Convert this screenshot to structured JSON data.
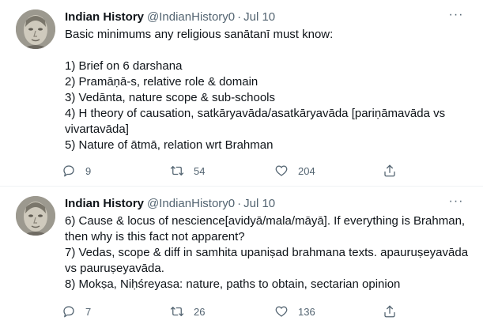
{
  "author": {
    "name": "Indian History",
    "handle": "@IndianHistory0",
    "separator": "·"
  },
  "more_glyph": "···",
  "tweets": [
    {
      "date": "Jul 10",
      "lines": [
        "Basic minimums any religious sanātanī must know:",
        "",
        "1) Brief on 6 darshana",
        "2) Pramāṇā-s, relative role & domain",
        "3) Vedānta, nature scope & sub-schools",
        "4) H theory of causation, satkāryavāda/asatkāryavāda [pariṇāmavāda vs",
        "vivartavāda]",
        "5) Nature of ātmā, relation wrt Brahman"
      ],
      "replies": "9",
      "retweets": "54",
      "likes": "204"
    },
    {
      "date": "Jul 10",
      "lines": [
        "6) Cause & locus of nescience[avidyā/mala/māyā]. If everything is Brahman,",
        "then why is this fact not apparent?",
        "7) Vedas, scope & diff in samhita upaniṣad brahmana texts. apauruṣeyavāda",
        "vs pauruṣeyavāda.",
        "8) Mokṣa, Niḥśreyasa: nature, paths to obtain, sectarian opinion"
      ],
      "replies": "7",
      "retweets": "26",
      "likes": "136"
    }
  ],
  "icons": {
    "reply": "reply-icon",
    "retweet": "retweet-icon",
    "like": "heart-icon",
    "share": "share-icon"
  }
}
